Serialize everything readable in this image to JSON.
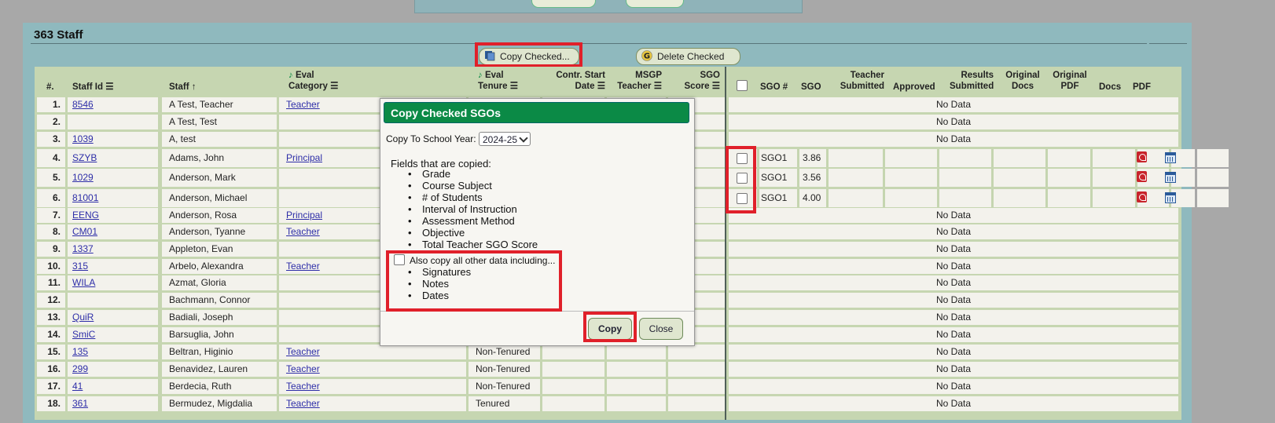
{
  "frame": {
    "title": "363 Staff"
  },
  "toolbar": {
    "copy_checked": "Copy Checked...",
    "delete_checked": "Delete Checked"
  },
  "columns": {
    "num": "#.",
    "staff_id": "Staff Id",
    "staff": "Staff",
    "eval_category": [
      "Eval",
      "Category"
    ],
    "eval_tenure": [
      "Eval",
      "Tenure"
    ],
    "contr_start": [
      "Contr. Start",
      "Date"
    ],
    "msgp": [
      "MSGP",
      "Teacher"
    ],
    "sgo_score": [
      "SGO",
      "Score"
    ],
    "sgo_num": "SGO #",
    "sgo": "SGO",
    "teacher_submitted": [
      "Teacher",
      "Submitted"
    ],
    "approved": "Approved",
    "results_submitted": [
      "Results",
      "Submitted"
    ],
    "original_docs": [
      "Original",
      "Docs"
    ],
    "original_pdf": [
      "Original",
      "PDF"
    ],
    "docs": "Docs",
    "pdf": "PDF"
  },
  "rows": [
    {
      "num": "1.",
      "id": "8546",
      "staff": "A Test, Teacher",
      "category": "Teacher",
      "tenure": "",
      "nodata": "No Data"
    },
    {
      "num": "2.",
      "id": "",
      "staff": "A Test, Test",
      "category": "",
      "tenure": "",
      "nodata": "No Data"
    },
    {
      "num": "3.",
      "id": "1039",
      "staff": "A, test",
      "category": "",
      "tenure": "",
      "nodata": "No Data"
    },
    {
      "num": "4.",
      "id": "SZYB",
      "staff": "Adams, John",
      "category": "Principal",
      "tenure": "",
      "sgo_num": "SGO1",
      "sgo": "3.86"
    },
    {
      "num": "5.",
      "id": "1029",
      "staff": "Anderson, Mark",
      "category": "",
      "tenure": "",
      "sgo_num": "SGO1",
      "sgo": "3.56"
    },
    {
      "num": "6.",
      "id": "81001",
      "staff": "Anderson, Michael",
      "category": "",
      "tenure": "",
      "sgo_num": "SGO1",
      "sgo": "4.00"
    },
    {
      "num": "7.",
      "id": "EENG",
      "staff": "Anderson, Rosa",
      "category": "Principal",
      "tenure": "",
      "nodata": "No Data"
    },
    {
      "num": "8.",
      "id": "CM01",
      "staff": "Anderson, Tyanne",
      "category": "Teacher",
      "tenure": "",
      "nodata": "No Data"
    },
    {
      "num": "9.",
      "id": "1337",
      "staff": "Appleton, Evan",
      "category": "",
      "tenure": "",
      "nodata": "No Data"
    },
    {
      "num": "10.",
      "id": "315",
      "staff": "Arbelo, Alexandra",
      "category": "Teacher",
      "tenure": "",
      "nodata": "No Data"
    },
    {
      "num": "11.",
      "id": "WILA",
      "staff": "Azmat, Gloria",
      "category": "",
      "tenure": "",
      "nodata": "No Data"
    },
    {
      "num": "12.",
      "id": "",
      "staff": "Bachmann, Connor",
      "category": "",
      "tenure": "",
      "nodata": "No Data"
    },
    {
      "num": "13.",
      "id": "QuiR",
      "staff": "Badiali, Joseph",
      "category": "",
      "tenure": "",
      "nodata": "No Data"
    },
    {
      "num": "14.",
      "id": "SmiC",
      "staff": "Barsuglia, John",
      "category": "",
      "tenure": "",
      "nodata": "No Data"
    },
    {
      "num": "15.",
      "id": "135",
      "staff": "Beltran, Higinio",
      "category": "Teacher",
      "tenure": "Non-Tenured",
      "nodata": "No Data"
    },
    {
      "num": "16.",
      "id": "299",
      "staff": "Benavidez, Lauren",
      "category": "Teacher",
      "tenure": "Non-Tenured",
      "nodata": "No Data"
    },
    {
      "num": "17.",
      "id": "41",
      "staff": "Berdecia, Ruth",
      "category": "Teacher",
      "tenure": "Non-Tenured",
      "nodata": "No Data"
    },
    {
      "num": "18.",
      "id": "361",
      "staff": "Bermudez, Migdalia",
      "category": "Teacher",
      "tenure": "Tenured",
      "nodata": "No Data"
    }
  ],
  "dialog": {
    "title": "Copy Checked SGOs",
    "year_label": "Copy To School Year:",
    "year_value": "2024-25",
    "fields_label": "Fields that are copied:",
    "fields": [
      "Grade",
      "Course Subject",
      "# of Students",
      "Interval of Instruction",
      "Assessment Method",
      "Objective",
      "Total Teacher SGO Score"
    ],
    "also_label": "Also copy all other data including...",
    "also_items": [
      "Signatures",
      "Notes",
      "Dates"
    ],
    "copy": "Copy",
    "close": "Close"
  },
  "colors": {
    "highlight": "#e0202a",
    "title_bar": "#0b8a46",
    "link": "#2e2ea8"
  }
}
